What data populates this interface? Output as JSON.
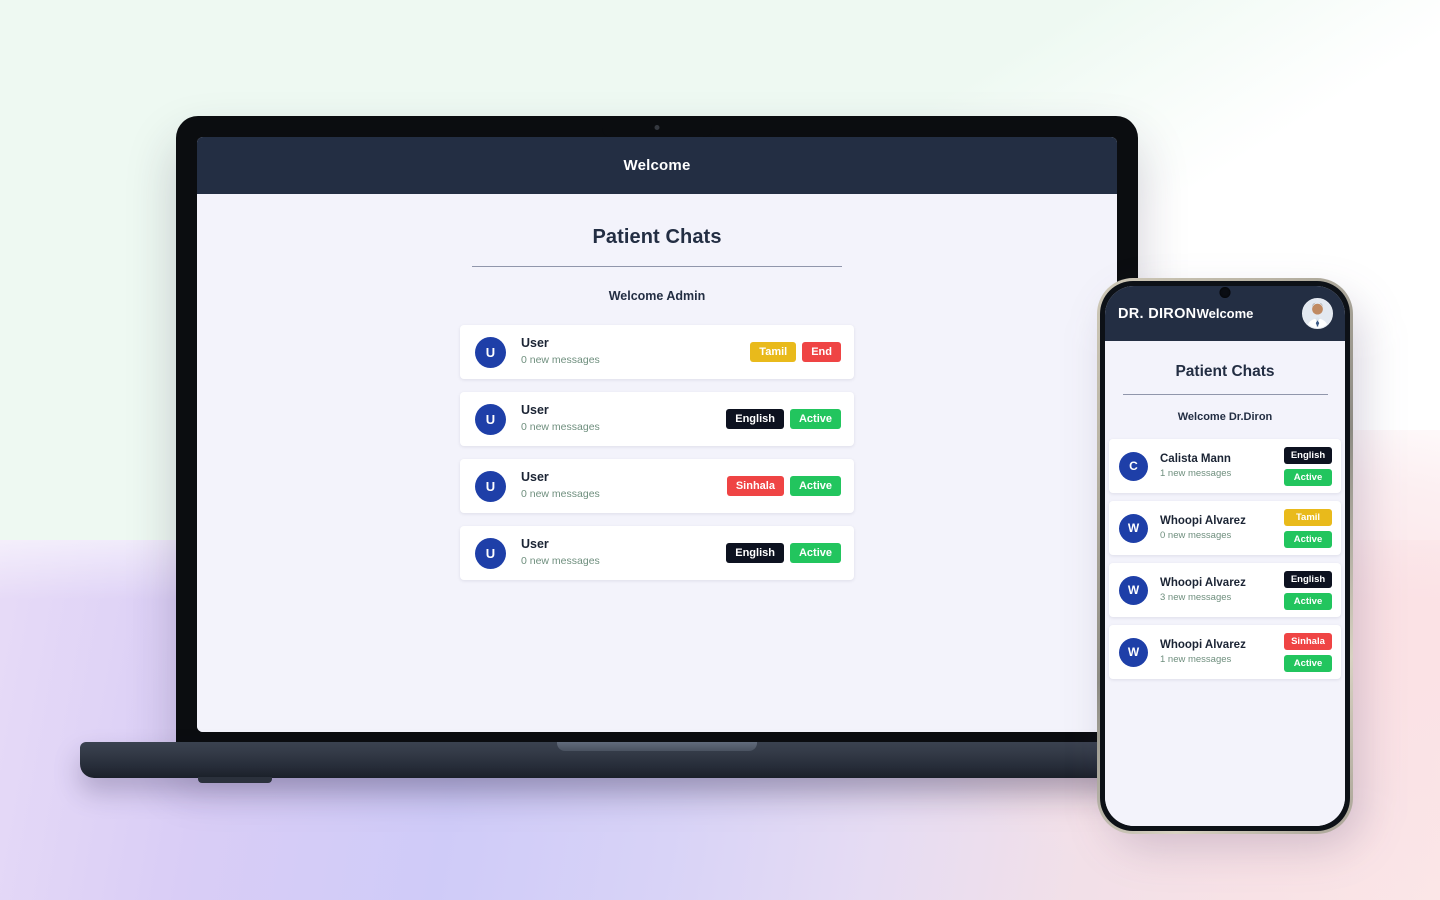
{
  "theme": {
    "header_bg": "#232e43",
    "screen_bg": "#f3f3fb",
    "avatar_blue": "#1e3fa8",
    "badge_dark": "#0d1220",
    "badge_green": "#22c55e",
    "badge_red": "#ef4444",
    "badge_yellow": "#e9ba1b",
    "text_dark": "#1b2434",
    "text_muted_green": "#6f8f7e"
  },
  "laptop": {
    "header": {
      "title": "Welcome"
    },
    "page_title": "Patient Chats",
    "welcome_text": "Welcome Admin",
    "chats": [
      {
        "avatar_letter": "U",
        "name": "User",
        "messages": "0 new messages",
        "badges": [
          {
            "label": "Tamil",
            "style": "yellow"
          },
          {
            "label": "End",
            "style": "red"
          }
        ]
      },
      {
        "avatar_letter": "U",
        "name": "User",
        "messages": "0 new messages",
        "badges": [
          {
            "label": "English",
            "style": "dark"
          },
          {
            "label": "Active",
            "style": "green"
          }
        ]
      },
      {
        "avatar_letter": "U",
        "name": "User",
        "messages": "0 new messages",
        "badges": [
          {
            "label": "Sinhala",
            "style": "red"
          },
          {
            "label": "Active",
            "style": "green"
          }
        ]
      },
      {
        "avatar_letter": "U",
        "name": "User",
        "messages": "0 new messages",
        "badges": [
          {
            "label": "English",
            "style": "dark"
          },
          {
            "label": "Active",
            "style": "green"
          }
        ]
      }
    ]
  },
  "phone": {
    "header": {
      "brand": "DR. DIRON",
      "title": "Welcome",
      "avatar_icon": "doctor-avatar-photo"
    },
    "page_title": "Patient Chats",
    "welcome_text": "Welcome Dr.Diron",
    "chats": [
      {
        "avatar_letter": "C",
        "name": "Calista Mann",
        "messages": "1 new messages",
        "badges": [
          {
            "label": "English",
            "style": "dark"
          },
          {
            "label": "Active",
            "style": "green"
          }
        ]
      },
      {
        "avatar_letter": "W",
        "name": "Whoopi Alvarez",
        "messages": "0 new messages",
        "badges": [
          {
            "label": "Tamil",
            "style": "yellow"
          },
          {
            "label": "Active",
            "style": "green"
          }
        ]
      },
      {
        "avatar_letter": "W",
        "name": "Whoopi Alvarez",
        "messages": "3 new messages",
        "badges": [
          {
            "label": "English",
            "style": "dark"
          },
          {
            "label": "Active",
            "style": "green"
          }
        ]
      },
      {
        "avatar_letter": "W",
        "name": "Whoopi Alvarez",
        "messages": "1 new messages",
        "badges": [
          {
            "label": "Sinhala",
            "style": "red"
          },
          {
            "label": "Active",
            "style": "green"
          }
        ]
      }
    ]
  }
}
